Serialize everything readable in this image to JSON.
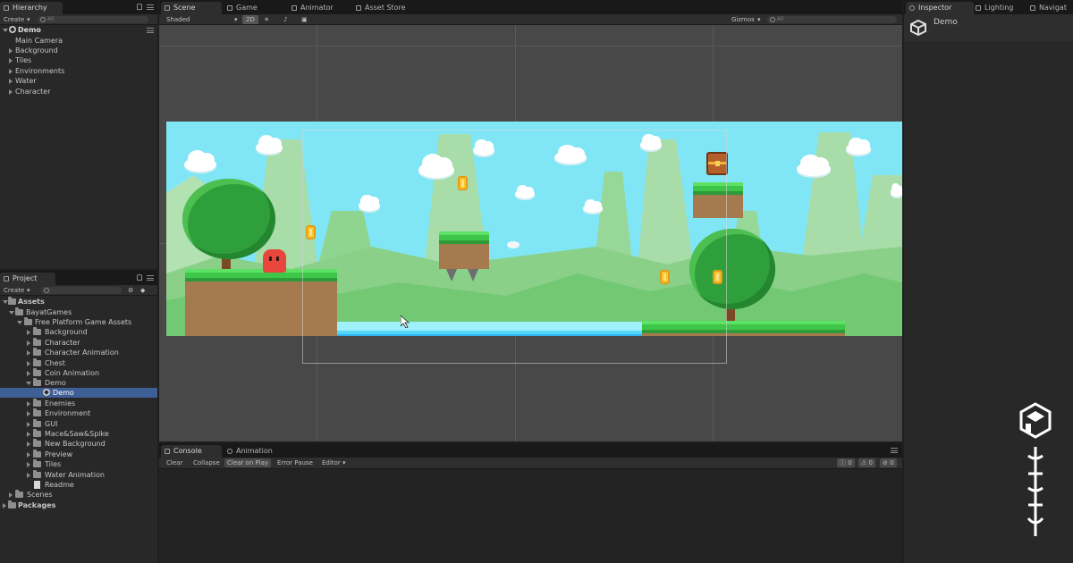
{
  "hierarchy": {
    "tab": "Hierarchy",
    "create_label": "Create",
    "search_placeholder": "All",
    "scene_name": "Demo",
    "items": [
      "Main Camera",
      "Background",
      "Tiles",
      "Environments",
      "Water",
      "Character"
    ]
  },
  "project": {
    "tab": "Project",
    "create_label": "Create",
    "root": "Assets",
    "bayat": "BayatGames",
    "free": "Free Platform Game Assets",
    "folders": [
      "Background",
      "Character",
      "Character Animation",
      "Chest",
      "Coin Animation"
    ],
    "demo_folder": "Demo",
    "demo_scene": "Demo",
    "folders2": [
      "Enemies",
      "Environment",
      "GUI",
      "Mace&Saw&Spike",
      "New Background",
      "Preview",
      "Tiles",
      "Water Animation"
    ],
    "readme": "Readme",
    "scenes": "Scenes",
    "packages": "Packages"
  },
  "scene_tabs": [
    "Scene",
    "Game",
    "Animator",
    "Asset Store"
  ],
  "scene_toolbar": {
    "shading": "Shaded",
    "mode_2d": "2D",
    "gizmos": "Gizmos",
    "search_placeholder": "All"
  },
  "bottom_tabs": [
    "Console",
    "Animation"
  ],
  "console_toolbar": {
    "buttons": [
      "Clear",
      "Collapse",
      "Clear on Play",
      "Error Pause",
      "Editor"
    ],
    "counts": [
      "0",
      "0",
      "0"
    ]
  },
  "inspector": {
    "tabs": [
      "Inspector",
      "Lighting",
      "Navigat"
    ],
    "object_name": "Demo"
  },
  "colors": {
    "sky": "#80e6f6",
    "grass": "#3ec64a",
    "water": "#2fb3f2",
    "selection": "#3e5f96"
  }
}
